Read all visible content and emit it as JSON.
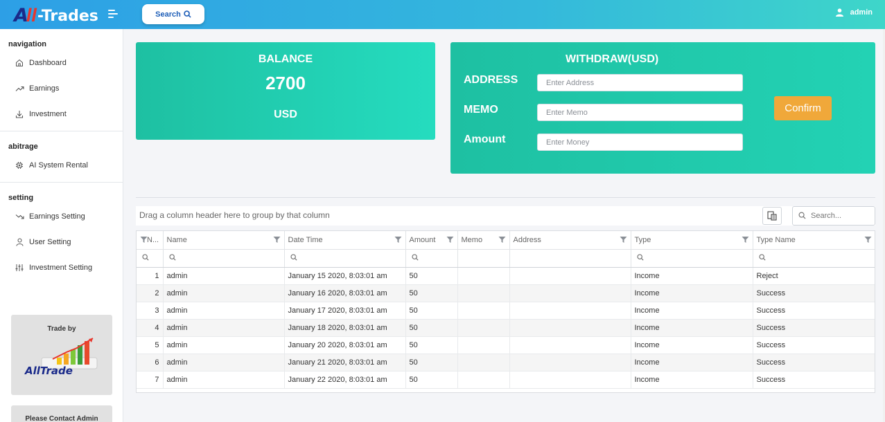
{
  "header": {
    "logo": {
      "a": "A",
      "mark": "ll",
      "trades": "-Trades"
    },
    "search_label": "Search",
    "user_name": "admin"
  },
  "sidebar": {
    "sections": [
      {
        "title": "navigation",
        "items": [
          {
            "label": "Dashboard",
            "icon": "home-icon"
          },
          {
            "label": "Earnings",
            "icon": "trending-up-icon"
          },
          {
            "label": "Investment",
            "icon": "download-icon"
          }
        ]
      },
      {
        "title": "abitrage",
        "items": [
          {
            "label": "AI System Rental",
            "icon": "cpu-icon"
          }
        ]
      },
      {
        "title": "setting",
        "items": [
          {
            "label": "Earnings Setting",
            "icon": "trending-down-icon"
          },
          {
            "label": "User Setting",
            "icon": "user-icon"
          },
          {
            "label": "Investment Setting",
            "icon": "sliders-icon"
          }
        ]
      }
    ],
    "promo": {
      "trade_by": "Trade by",
      "brand_a": "A",
      "brand_rest": "llTrade"
    },
    "contact": "Please Contact Admin"
  },
  "balance": {
    "label": "BALANCE",
    "value": "2700",
    "unit": "USD"
  },
  "withdraw": {
    "title": "WITHDRAW(USD)",
    "fields": [
      {
        "label": "ADDRESS",
        "placeholder": "Enter Address"
      },
      {
        "label": "MEMO",
        "placeholder": "Enter Memo"
      },
      {
        "label": "Amount",
        "placeholder": "Enter Money"
      }
    ],
    "confirm_label": "Confirm"
  },
  "grid": {
    "group_panel_text": "Drag a column header here to group by that column",
    "search_placeholder": "Search...",
    "columns": [
      "N...",
      "Name",
      "Date Time",
      "Amount",
      "Memo",
      "Address",
      "Type",
      "Type Name"
    ],
    "rows": [
      [
        "1",
        "admin",
        "January 15 2020, 8:03:01 am",
        "50",
        "",
        "",
        "Income",
        "Reject"
      ],
      [
        "2",
        "admin",
        "January 16 2020, 8:03:01 am",
        "50",
        "",
        "",
        "Income",
        "Success"
      ],
      [
        "3",
        "admin",
        "January 17 2020, 8:03:01 am",
        "50",
        "",
        "",
        "Income",
        "Success"
      ],
      [
        "4",
        "admin",
        "January 18 2020, 8:03:01 am",
        "50",
        "",
        "",
        "Income",
        "Success"
      ],
      [
        "5",
        "admin",
        "January 20 2020, 8:03:01 am",
        "50",
        "",
        "",
        "Income",
        "Success"
      ],
      [
        "6",
        "admin",
        "January 21 2020, 8:03:01 am",
        "50",
        "",
        "",
        "Income",
        "Success"
      ],
      [
        "7",
        "admin",
        "January 22 2020, 8:03:01 am",
        "50",
        "",
        "",
        "Income",
        "Success"
      ]
    ]
  },
  "colors": {
    "header_start": "#2d9fe6",
    "header_end": "#3ed6c9",
    "card": "#1ec0a2",
    "confirm": "#f0a83a",
    "logo_blue": "#1a2a8a",
    "logo_red": "#e8362c"
  }
}
